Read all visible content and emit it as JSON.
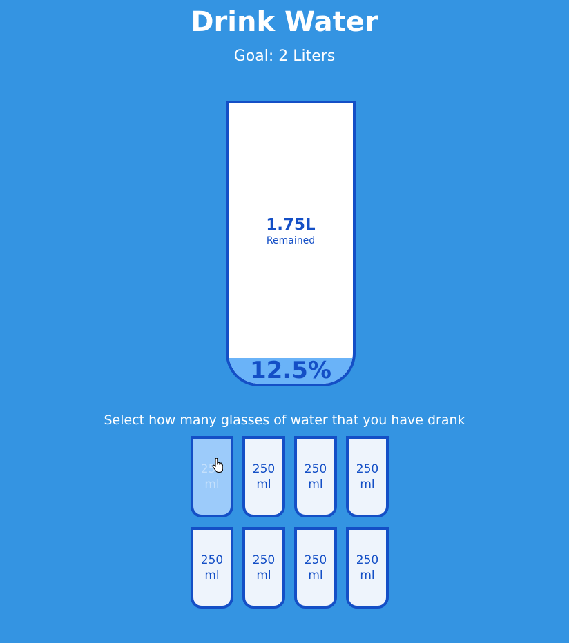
{
  "header": {
    "title": "Drink Water",
    "goal": "Goal: 2 Liters"
  },
  "big_cup": {
    "remained_amount": "1.75L",
    "remained_label": "Remained",
    "percentage": "12.5%",
    "fill_fraction": 0.125
  },
  "instruction": "Select how many glasses of water that you have drank",
  "cups": [
    {
      "amount": "250",
      "unit": "ml",
      "full": true
    },
    {
      "amount": "250",
      "unit": "ml",
      "full": false
    },
    {
      "amount": "250",
      "unit": "ml",
      "full": false
    },
    {
      "amount": "250",
      "unit": "ml",
      "full": false
    },
    {
      "amount": "250",
      "unit": "ml",
      "full": false
    },
    {
      "amount": "250",
      "unit": "ml",
      "full": false
    },
    {
      "amount": "250",
      "unit": "ml",
      "full": false
    },
    {
      "amount": "250",
      "unit": "ml",
      "full": false
    }
  ],
  "colors": {
    "background": "#3494e2",
    "accent": "#144fc6",
    "water": "#6ab3f8",
    "cup_empty": "#eef4fc",
    "cup_full": "#9ccbfa"
  },
  "cursor_icon": "hand-pointer-icon"
}
